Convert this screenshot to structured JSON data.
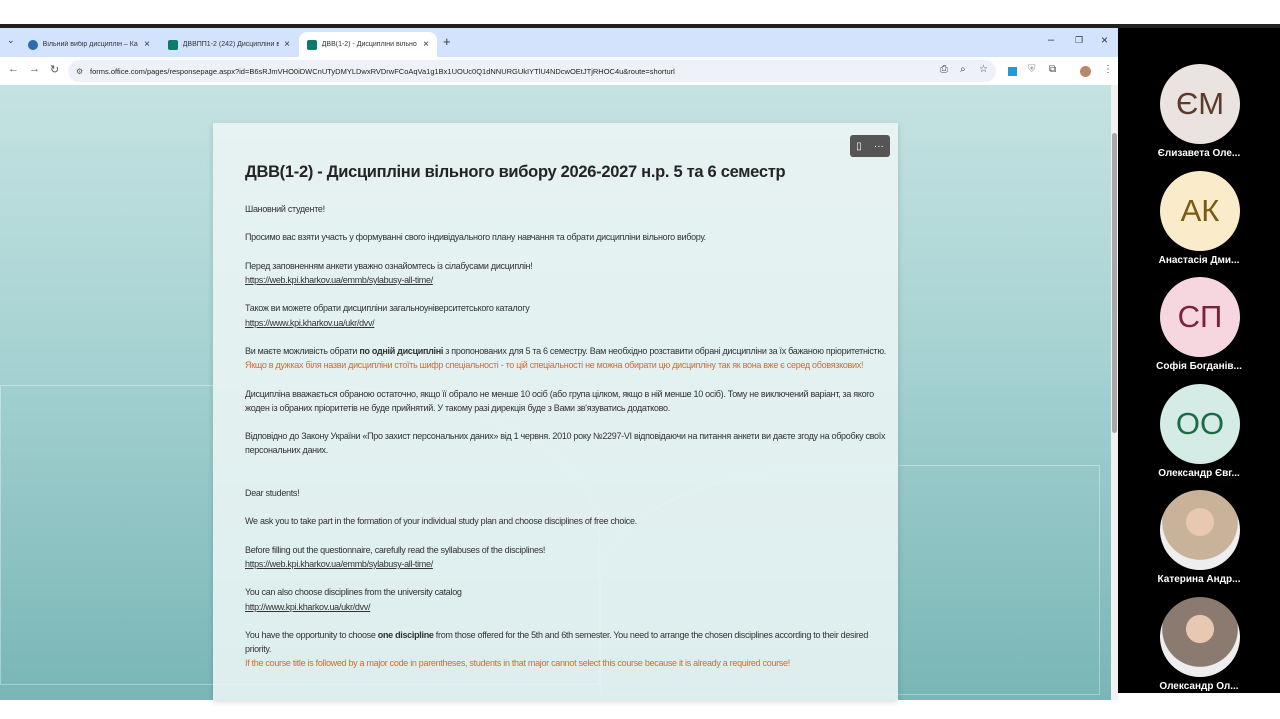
{
  "browser": {
    "tabs": [
      {
        "title": "Вільний вибір дисциплін – Ка",
        "icon": "wordpress-icon",
        "color": "#2b6cb0"
      },
      {
        "title": "ДВВПП1-2 (242) Дисципліни в",
        "icon": "forms-icon",
        "color": "#0e7a6c"
      },
      {
        "title": "ДВВ(1-2) - Дисципліни вільно",
        "icon": "forms-icon",
        "color": "#0e7a6c"
      }
    ],
    "url": "forms.office.com/pages/responsepage.aspx?id=B6sRJmVHO0iDWCnUTyDMYLDwxRVDrwFCoAqVa1g1Bx1UOUc0Q1dNNURGUkIYTlU4NDcwOEtJTjRHOC4u&route=shorturl"
  },
  "form": {
    "title": "ДВВ(1-2) - Дисципліни вільного вибору 2026-2027 н.р. 5 та 6 семестр",
    "greeting_ua": "Шановний студенте!",
    "p1_ua": "Просимо вас взяти участь у формуванні свого індивідуального плану навчання та обрати дисципліни вільного вибору.",
    "p2_ua": "Перед заповненням анкети уважно ознайомтесь із сілабусами дисциплін!",
    "link1_ua": "https://web.kpi.kharkov.ua/emmb/sylabusy-all-time/",
    "p3_ua": "Також ви можете обрати дисципліни загальноуніверситетського каталогу",
    "link2_ua": "https://www.kpi.kharkov.ua/ukr/dvv/",
    "p4a_ua": "Ви маєте можливість обрати ",
    "p4b_ua": "по одній дисципліні",
    "p4c_ua": " з пропонованих для 5 та 6 семестру. Вам необхідно розставити обрані дисципліни за їх бажаною пріоритетністю.",
    "warn_ua": "Якщо в дужках біля назви дисципліни стоїть шифр спеціальності - то цій спеціальності не можна обирати цю дисципліну так як вона вже є серед обовязкових!",
    "p5_ua": "Дисципліна вважається обраною остаточно, якщо її обрало не менше 10 осіб (або група цілком, якщо в ній менше 10 осіб). Тому не виключений варіант, за якого жоден із обраних пріоритетів не буде прийнятий. У такому разі дирекція буде з Вами зв'язуватись додатково.",
    "p6_ua": "Відповідно до Закону України «Про захист персональних даних» від 1 червня. 2010 року №2297-VI відповідаючи на питання анкети ви даєте згоду на обробку своїх персональних даних.",
    "greeting_en": "Dear students!",
    "p1_en": "We ask you to take part in the formation of your individual study plan and choose disciplines of free choice.",
    "p2_en": "Before filling out the questionnaire, carefully read the syllabuses of the disciplines!",
    "link1_en": "https://web.kpi.kharkov.ua/emmb/sylabusy-all-time/",
    "p3_en": "You can also choose disciplines from the university catalog",
    "link2_en": "http://www.kpi.kharkov.ua/ukr/dvv/",
    "p4a_en": "You have the opportunity to choose ",
    "p4b_en": "one discipline",
    "p4c_en": " from those offered for the 5th and 6th semester. You need to arrange the chosen disciplines according to their desired priority.",
    "warn_en": "If the course title is followed by a major code in parentheses, students in that major cannot select this course because it is already a required course!"
  },
  "participants": [
    {
      "initials": "ЄМ",
      "name": "Єлизавета Оле...",
      "bg": "#ebe3e0",
      "fg": "#5a3b2c"
    },
    {
      "initials": "АК",
      "name": "Анастасія Дми...",
      "bg": "#faeccb",
      "fg": "#7a5a10"
    },
    {
      "initials": "СП",
      "name": "Софія Богданів...",
      "bg": "#f6d7df",
      "fg": "#7a2338"
    },
    {
      "initials": "ОО",
      "name": "Олександр Євг...",
      "bg": "#d5ece6",
      "fg": "#1d6a47"
    },
    {
      "initials": "",
      "name": "Катерина Андр...",
      "bg": "#c9b29a",
      "fg": "#000"
    },
    {
      "initials": "",
      "name": "Олександр Ол...",
      "bg": "#8a7a70",
      "fg": "#000"
    }
  ]
}
